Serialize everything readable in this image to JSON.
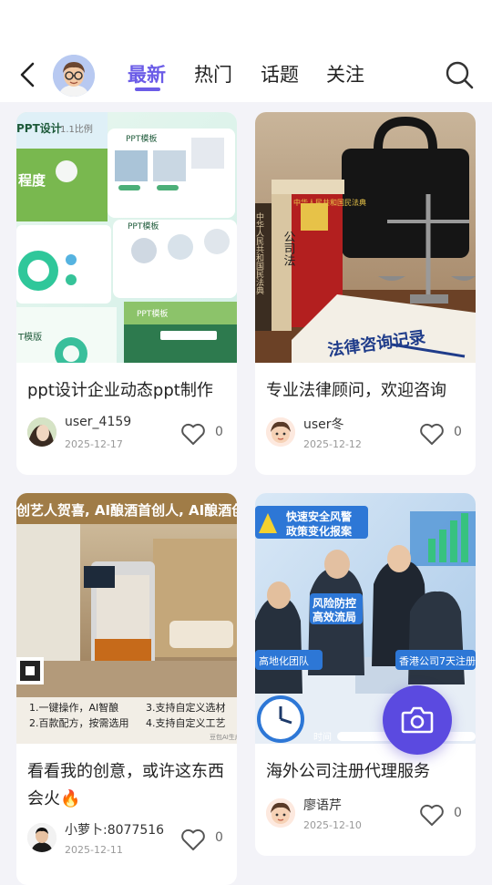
{
  "header": {
    "tabs": [
      {
        "label": "最新",
        "active": true
      },
      {
        "label": "热门",
        "active": false
      },
      {
        "label": "话题",
        "active": false
      },
      {
        "label": "关注",
        "active": false
      }
    ],
    "accent_color": "#6b5ce7"
  },
  "posts": [
    {
      "title": "ppt设计企业动态ppt制作",
      "user": "user_4159",
      "date": "2025-12-17",
      "likes": "0",
      "image_texts": {
        "t1": "PPT设计",
        "t2": "1.1比例",
        "t3": "PPT模板",
        "t4": "程度",
        "t5": "PPT模板",
        "t6": "PPT模板",
        "t7": "T模版"
      }
    },
    {
      "title": "专业法律顾问，欢迎咨询",
      "user": "user冬",
      "date": "2025-12-12",
      "likes": "0",
      "image_texts": {
        "b1": "中华人民共和国民法典",
        "b2": "公司法",
        "b3": "中华人民共和国民法典",
        "note": "法律咨询记录"
      }
    },
    {
      "title": "看看我的创意，或许这东西会火🔥",
      "user": "小萝卜:8077516",
      "date": "2025-12-11",
      "likes": "0",
      "image_texts": {
        "banner": "创艺人贺喜, AI酿酒首创人, AI酿酒创意",
        "f1": "1.一键操作，AI智酿",
        "f2": "2.百款配方，按需选用",
        "f3": "3.支持自定义选材",
        "f4": "4.支持自定义工艺",
        "wm": "豆包AI生成"
      }
    },
    {
      "title": "海外公司注册代理服务",
      "user": "廖语芹",
      "date": "2025-12-10",
      "likes": "0",
      "image_texts": {
        "l1": "快速安全风警",
        "l2": "政策变化报案",
        "l3": "风险防控",
        "l4": "高效流局",
        "l5": "高地化团队",
        "l6": "香港公司7天注册",
        "l7": "时间"
      }
    }
  ]
}
